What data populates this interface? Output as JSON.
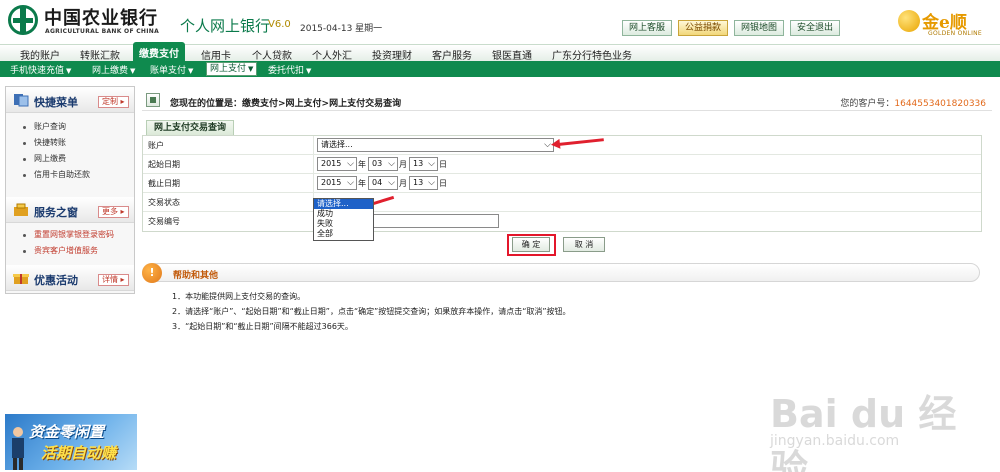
{
  "header": {
    "bank_name_cn": "中国农业银行",
    "bank_name_en": "AGRICULTURAL BANK OF CHINA",
    "system_title": "个人网上银行",
    "version": "V6.0",
    "date": "2015-04-13 星期一",
    "top_buttons": [
      "网上客服",
      "公益捐款",
      "网银地图",
      "安全退出"
    ],
    "golden_cn": "金e顺",
    "golden_en": "GOLDEN ONLINE"
  },
  "nav_main": [
    "我的账户",
    "转账汇款",
    "缴费支付",
    "信用卡",
    "个人贷款",
    "个人外汇",
    "投资理财",
    "客户服务",
    "银医直通",
    "广东分行特色业务"
  ],
  "nav_main_active": 2,
  "nav_sub": [
    "手机快速充值",
    "网上缴费",
    "账单支付",
    "网上支付",
    "委托代扣"
  ],
  "nav_sub_active": 3,
  "sidebar": {
    "quick_menu_title": "快捷菜单",
    "quick_menu_button": "定制",
    "quick_menu_items": [
      "账户查询",
      "快捷转账",
      "网上缴费",
      "信用卡自助还款"
    ],
    "service_title": "服务之窗",
    "service_button": "更多",
    "service_items": [
      "重置网银掌银登录密码",
      "贵宾客户增值服务"
    ],
    "promo_title": "优惠活动",
    "promo_button": "详情"
  },
  "ad": {
    "line1": "资金零闲置",
    "line2": "活期自动赚"
  },
  "breadcrumb": "您现在的位置是：缴费支付>网上支付>网上支付交易查询",
  "customer_label": "您的客户号：",
  "customer_number": "1644553401820336",
  "tab_title": "网上支付交易查询",
  "form": {
    "account_label": "账户",
    "account_value": "请选择...",
    "start_label": "起始日期",
    "start_year": "2015",
    "start_month": "03",
    "start_day": "13",
    "end_label": "截止日期",
    "end_year": "2015",
    "end_month": "04",
    "end_day": "13",
    "year_unit": "年",
    "month_unit": "月",
    "day_unit": "日",
    "status_label": "交易状态",
    "status_options": [
      "请选择...",
      "成功",
      "失败",
      "全部"
    ],
    "txn_no_label": "交易编号",
    "txn_no_value": ""
  },
  "buttons": {
    "confirm": "确 定",
    "cancel": "取 消"
  },
  "help": {
    "title": "帮助和其他",
    "lines": [
      "1．本功能提供网上支付交易的查询。",
      "2．请选择“账户”、“起始日期”和“截止日期”，点击“确定”按钮提交查询；如果放弃本操作，请点击“取消”按钮。",
      "3．“起始日期”和“截止日期”间隔不能超过366天。"
    ]
  },
  "watermark": {
    "brand": "Bai du 经验",
    "url": "jingyan.baidu.com"
  },
  "colors": {
    "brand_green": "#0f8a4e",
    "highlight_red": "#e3172b",
    "accent_orange": "#e26a1c"
  }
}
